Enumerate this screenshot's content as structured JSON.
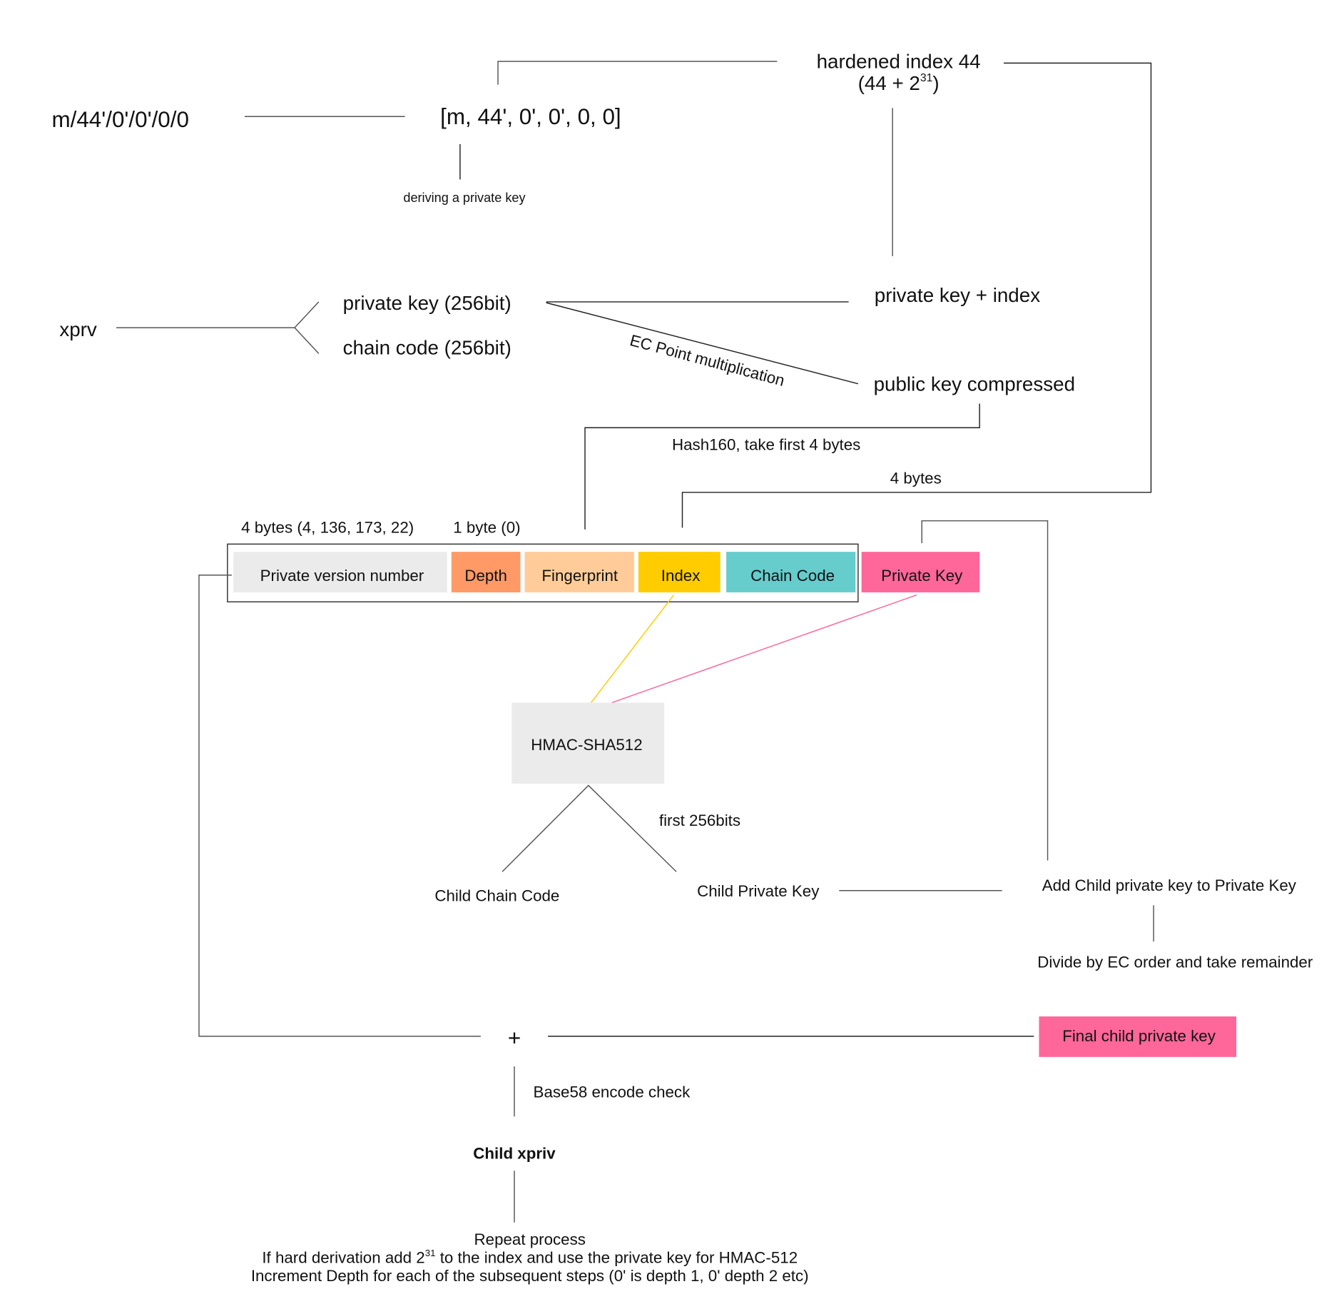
{
  "path": {
    "notation": "m/44'/0'/0'/0/0",
    "array": "[m, 44', 0', 0', 0, 0]",
    "deriving_label": "deriving a private key"
  },
  "hardened": {
    "line1": "hardened index 44",
    "line2_prefix": "(44 + 2",
    "line2_sup": "31",
    "line2_suffix": ")"
  },
  "xprv": {
    "label": "xprv",
    "private_key": "private key (256bit)",
    "chain_code": "chain code (256bit)"
  },
  "derivation": {
    "private_key_plus_index": "private key  + index",
    "ec_point_label": "EC Point multiplication",
    "public_key": "public key compressed",
    "hash160_label": "Hash160, take first 4 bytes",
    "four_bytes_label": "4 bytes"
  },
  "structure": {
    "version_bytes_label": "4 bytes (4, 136, 173, 22)",
    "depth_bytes_label": "1 byte (0)",
    "fields": [
      {
        "label": "Private version number",
        "color": "#EBEBEB"
      },
      {
        "label": "Depth",
        "color": "#FF9966"
      },
      {
        "label": "Fingerprint",
        "color": "#FFCC99"
      },
      {
        "label": "Index",
        "color": "#FFCC00"
      },
      {
        "label": "Chain Code",
        "color": "#66CCCC"
      },
      {
        "label": "Private Key",
        "color": "#FF6699"
      }
    ]
  },
  "hmac": {
    "label": "HMAC-SHA512",
    "first_bits_label": "first 256bits",
    "child_chain_code": "Child Chain Code",
    "child_private_key": "Child Private Key"
  },
  "combine": {
    "add_label": "Add Child private key to Private Key",
    "divide_label": "Divide by EC order and take remainder",
    "final_label": "Final child private key",
    "final_color": "#FF6699",
    "plus_symbol": "+",
    "base58_label": "Base58 encode check",
    "child_xpriv": "Child xpriv"
  },
  "repeat": {
    "line1": "Repeat process",
    "line2_prefix": "If hard derivation add 2",
    "line2_sup": "31",
    "line2_suffix": " to the index and use the private key for HMAC-512",
    "line3": "Increment Depth for each of the subsequent steps (0' is depth 1, 0' depth 2 etc)"
  },
  "colors": {
    "index_link": "#FFCC00",
    "private_key_link": "#FF6699",
    "hmac_box": "#EBEBEB"
  }
}
